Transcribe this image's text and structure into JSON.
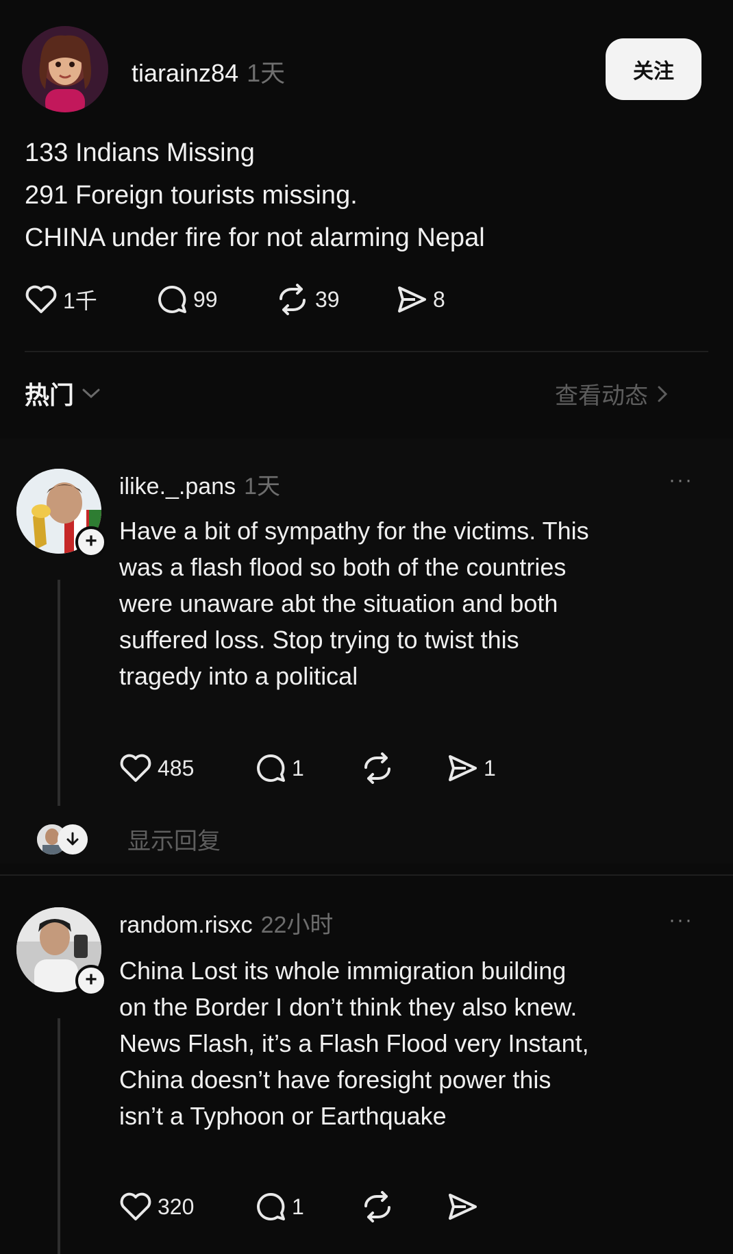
{
  "post": {
    "username": "tiarainz84",
    "time": "1天",
    "follow_label": "关注",
    "lines": [
      "133 Indians Missing",
      "291 Foreign tourists missing.",
      "CHINA under fire for not alarming Nepal"
    ],
    "actions": {
      "likes": "1千",
      "comments": "99",
      "reposts": "39",
      "shares": "8"
    }
  },
  "sort": {
    "label": "热门",
    "view_activity": "查看动态"
  },
  "replies": [
    {
      "username": "ilike._.pans",
      "time": "1天",
      "more": "···",
      "lines": [
        "Have a bit of sympathy for the victims. This",
        "was a flash flood so both of the countries",
        "were unaware abt the situation and both",
        "suffered loss. Stop trying to twist this",
        "tragedy into a political"
      ],
      "actions": {
        "likes": "485",
        "comments": "1",
        "reposts": "",
        "shares": "1"
      },
      "show_replies": "显示回复"
    },
    {
      "username": "random.risxc",
      "time": "22小时",
      "more": "···",
      "lines": [
        "China Lost its whole immigration building",
        "on the Border I don’t think they also knew.",
        "News Flash, it’s a Flash Flood very Instant,",
        "China doesn’t have foresight power this",
        "isn’t a Typhoon or Earthquake"
      ],
      "actions": {
        "likes": "320",
        "comments": "1",
        "reposts": "",
        "shares": ""
      }
    }
  ],
  "icons": {
    "like": "heart-icon",
    "comment": "comment-bubble-icon",
    "repost": "repost-icon",
    "share": "send-icon",
    "sort_chevron": "chevron-down-icon",
    "activity_chevron": "chevron-right-icon",
    "show_replies": "arrow-down-circle-icon"
  }
}
